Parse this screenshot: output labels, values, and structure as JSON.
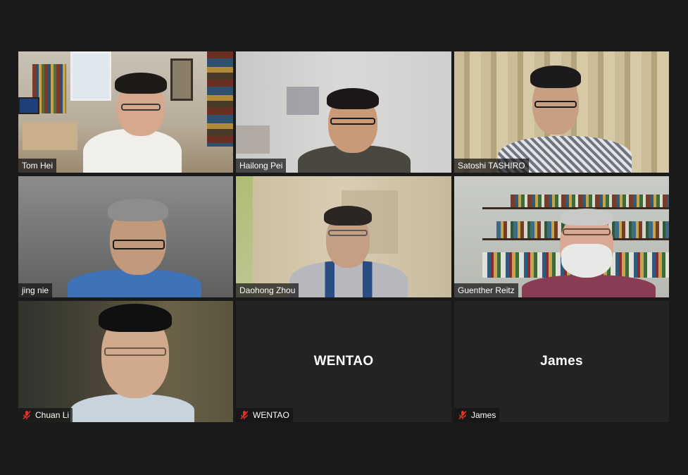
{
  "participants": [
    {
      "name": "Tom Hei",
      "video": true,
      "muted": false,
      "active": false
    },
    {
      "name": "Hailong Pei",
      "video": true,
      "muted": false,
      "active": false
    },
    {
      "name": "Satoshi TASHIRO",
      "video": true,
      "muted": false,
      "active": false
    },
    {
      "name": "jing nie",
      "video": true,
      "muted": false,
      "active": false
    },
    {
      "name": "Daohong Zhou",
      "video": true,
      "muted": false,
      "active": true
    },
    {
      "name": "Guenther Reitz",
      "video": true,
      "muted": false,
      "active": false
    },
    {
      "name": "Chuan Li",
      "video": true,
      "muted": true,
      "active": false
    },
    {
      "name": "WENTAO",
      "video": false,
      "muted": true,
      "active": false
    },
    {
      "name": "James",
      "video": false,
      "muted": true,
      "active": false
    }
  ],
  "colors": {
    "background": "#1a1a1a",
    "active_speaker_border": "#e8e85a",
    "muted_icon": "#e0322b"
  },
  "icons": {
    "muted": "microphone-muted-icon"
  }
}
